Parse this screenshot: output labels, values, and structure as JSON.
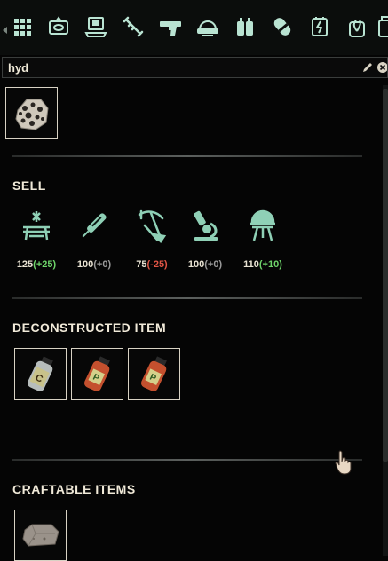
{
  "categories": [
    {
      "name": "all-categories-icon",
      "active": false
    },
    {
      "name": "data-items-icon",
      "active": false
    },
    {
      "name": "computer-icon",
      "active": false
    },
    {
      "name": "syringe-icon",
      "active": false
    },
    {
      "name": "pistol-icon",
      "active": false
    },
    {
      "name": "helmet-icon",
      "active": false
    },
    {
      "name": "backpack-icon",
      "active": false
    },
    {
      "name": "capsule-icon",
      "active": false
    },
    {
      "name": "power-icon",
      "active": false
    },
    {
      "name": "plant-jar-icon",
      "active": false
    },
    {
      "name": "container-icon",
      "active": false
    }
  ],
  "search": {
    "value": "hyd",
    "placeholder": ""
  },
  "selected_item": {
    "icon": "porous-rock-item-icon"
  },
  "sell": {
    "title": "SELL",
    "items": [
      {
        "icon": "workbench-icon",
        "base": "125",
        "delta": "(+25)",
        "tone": "pos"
      },
      {
        "icon": "syringe-tool-icon",
        "base": "100",
        "delta": "(+0)",
        "tone": "neu"
      },
      {
        "icon": "pickaxe-shovel-icon",
        "base": "75",
        "delta": "(-25)",
        "tone": "neg"
      },
      {
        "icon": "microscope-icon",
        "base": "100",
        "delta": "(+0)",
        "tone": "neu"
      },
      {
        "icon": "grill-icon",
        "base": "110",
        "delta": "(+10)",
        "tone": "pos"
      }
    ]
  },
  "deconstructed": {
    "title": "DECONSTRUCTED ITEM",
    "items": [
      {
        "icon": "chemical-jar-c-icon",
        "letter": "C",
        "color": "#c8c28a"
      },
      {
        "icon": "chemical-jar-p-icon",
        "letter": "P",
        "color": "#c4502e"
      },
      {
        "icon": "chemical-jar-p-icon",
        "letter": "P",
        "color": "#c4502e"
      }
    ]
  },
  "craftable": {
    "title": "CRAFTABLE ITEMS",
    "items": [
      {
        "icon": "stone-block-item-icon"
      }
    ]
  },
  "colors": {
    "accent": "#8fd0b6",
    "positive": "#6ed46a",
    "negative": "#e05545",
    "neutral": "#9a9a9a"
  }
}
